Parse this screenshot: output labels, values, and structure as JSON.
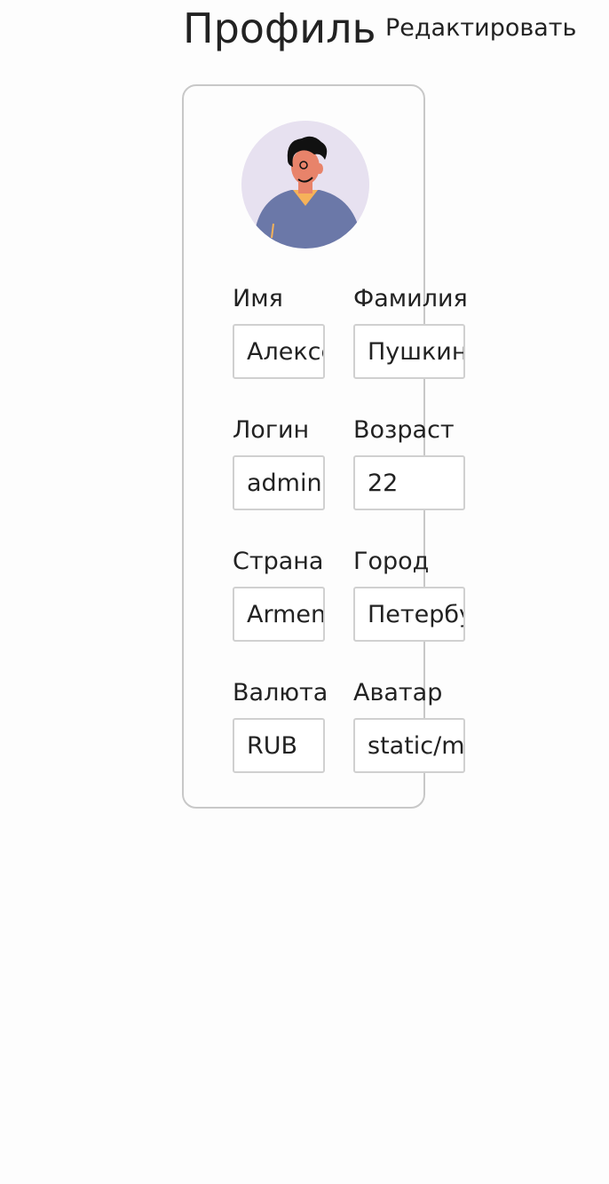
{
  "header": {
    "title": "Профиль",
    "edit_label": "Редактировать"
  },
  "profile": {
    "avatar_icon": "user-avatar-icon",
    "fields": {
      "first_name": {
        "label": "Имя",
        "value": "Алексей"
      },
      "last_name": {
        "label": "Фамилия",
        "value": "Пушкин"
      },
      "username": {
        "label": "Логин",
        "value": "admin"
      },
      "age": {
        "label": "Возраст",
        "value": "22"
      },
      "country": {
        "label": "Страна",
        "value": "Armenia"
      },
      "city": {
        "label": "Город",
        "value": "Петербург"
      },
      "currency": {
        "label": "Валюта",
        "value": "RUB"
      },
      "avatar": {
        "label": "Аватар",
        "value": "static/media/avatar.jpg"
      }
    }
  },
  "colors": {
    "background": "#fdfdfd",
    "card_border": "#c8c8c8",
    "input_border": "#d0d0d0",
    "avatar_bg": "#e7e1f0",
    "avatar_shirt": "#6b78a8"
  }
}
